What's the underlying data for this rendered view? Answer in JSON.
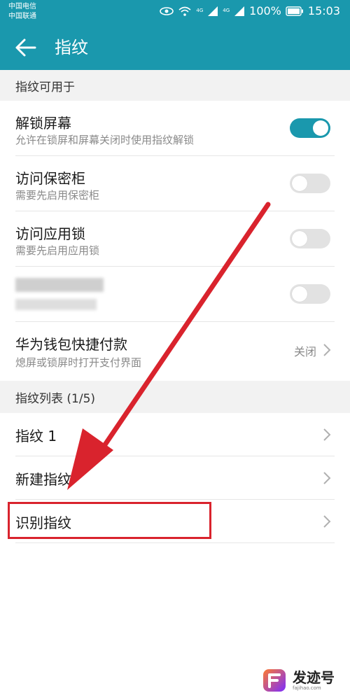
{
  "status_bar": {
    "carrier_1": "中国电信",
    "carrier_2": "中国联通",
    "signal_tag_1": "4G",
    "signal_tag_2": "4G",
    "battery_percent": "100%",
    "time": "15:03"
  },
  "app_bar": {
    "title": "指纹"
  },
  "section_usage": {
    "header": "指纹可用于",
    "items": [
      {
        "title": "解锁屏幕",
        "subtitle": "允许在锁屏和屏幕关闭时使用指纹解锁",
        "toggle_on": true
      },
      {
        "title": "访问保密柜",
        "subtitle": "需要先启用保密柜",
        "toggle_on": false
      },
      {
        "title": "访问应用锁",
        "subtitle": "需要先启用应用锁",
        "toggle_on": false
      },
      {
        "toggle_on": false
      },
      {
        "title": "华为钱包快捷付款",
        "subtitle": "熄屏或锁屏时打开支付界面",
        "value": "关闭"
      }
    ]
  },
  "section_list": {
    "header": "指纹列表 (1/5)",
    "items": [
      {
        "title": "指纹 1"
      },
      {
        "title": "新建指纹"
      },
      {
        "title": "识别指纹"
      }
    ]
  },
  "annotation": {
    "arrow_color": "#d9232d",
    "box_color": "#d9232d"
  },
  "watermark": {
    "name": "发迹号",
    "url": "fajihao.com"
  },
  "colors": {
    "accent": "#1a98ad",
    "section_bg": "#f2f2f2",
    "toggle_off": "#e2e2e2"
  }
}
